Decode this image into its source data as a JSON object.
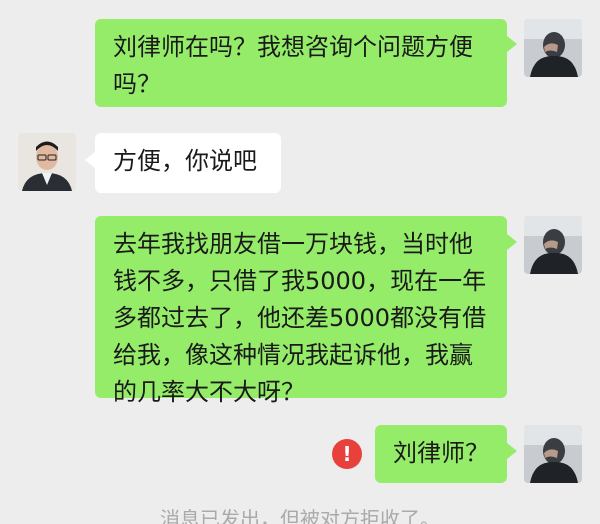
{
  "messages": [
    {
      "sender": "me",
      "text": "刘律师在吗？我想咨询个问题方便吗？"
    },
    {
      "sender": "lawyer",
      "text": "方便，你说吧"
    },
    {
      "sender": "me",
      "text": "去年我找朋友借一万块钱，当时他钱不多，只借了我5000，现在一年多都过去了，他还差5000都没有借给我，像这种情况我起诉他，我赢的几率大不大呀？"
    },
    {
      "sender": "me",
      "text": "刘律师？",
      "failed": true,
      "error_icon": "!"
    }
  ],
  "system_message": "消息已发出，但被对方拒收了。",
  "colors": {
    "background": "#ededed",
    "outgoing_bubble": "#95ec69",
    "incoming_bubble": "#ffffff",
    "error": "#e8413b"
  }
}
